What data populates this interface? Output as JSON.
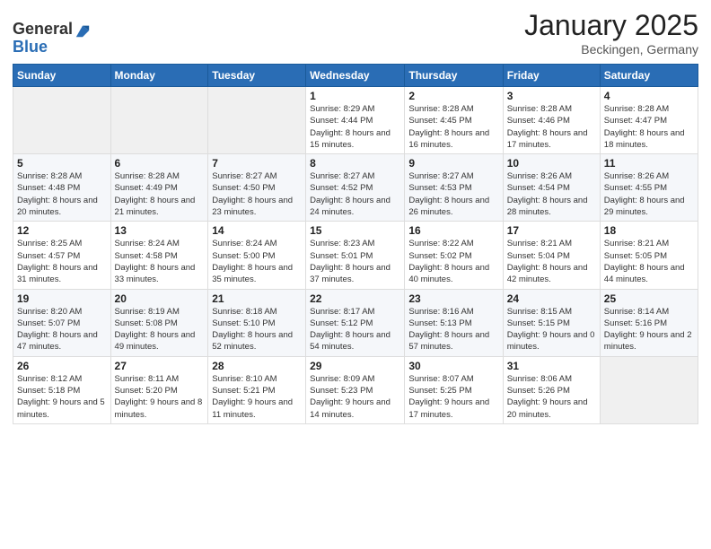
{
  "logo": {
    "general": "General",
    "blue": "Blue"
  },
  "calendar": {
    "title": "January 2025",
    "subtitle": "Beckingen, Germany"
  },
  "days": [
    "Sunday",
    "Monday",
    "Tuesday",
    "Wednesday",
    "Thursday",
    "Friday",
    "Saturday"
  ],
  "weeks": [
    [
      {
        "num": "",
        "info": "",
        "empty": true
      },
      {
        "num": "",
        "info": "",
        "empty": true
      },
      {
        "num": "",
        "info": "",
        "empty": true
      },
      {
        "num": "1",
        "info": "Sunrise: 8:29 AM\nSunset: 4:44 PM\nDaylight: 8 hours\nand 15 minutes."
      },
      {
        "num": "2",
        "info": "Sunrise: 8:28 AM\nSunset: 4:45 PM\nDaylight: 8 hours\nand 16 minutes."
      },
      {
        "num": "3",
        "info": "Sunrise: 8:28 AM\nSunset: 4:46 PM\nDaylight: 8 hours\nand 17 minutes."
      },
      {
        "num": "4",
        "info": "Sunrise: 8:28 AM\nSunset: 4:47 PM\nDaylight: 8 hours\nand 18 minutes."
      }
    ],
    [
      {
        "num": "5",
        "info": "Sunrise: 8:28 AM\nSunset: 4:48 PM\nDaylight: 8 hours\nand 20 minutes."
      },
      {
        "num": "6",
        "info": "Sunrise: 8:28 AM\nSunset: 4:49 PM\nDaylight: 8 hours\nand 21 minutes."
      },
      {
        "num": "7",
        "info": "Sunrise: 8:27 AM\nSunset: 4:50 PM\nDaylight: 8 hours\nand 23 minutes."
      },
      {
        "num": "8",
        "info": "Sunrise: 8:27 AM\nSunset: 4:52 PM\nDaylight: 8 hours\nand 24 minutes."
      },
      {
        "num": "9",
        "info": "Sunrise: 8:27 AM\nSunset: 4:53 PM\nDaylight: 8 hours\nand 26 minutes."
      },
      {
        "num": "10",
        "info": "Sunrise: 8:26 AM\nSunset: 4:54 PM\nDaylight: 8 hours\nand 28 minutes."
      },
      {
        "num": "11",
        "info": "Sunrise: 8:26 AM\nSunset: 4:55 PM\nDaylight: 8 hours\nand 29 minutes."
      }
    ],
    [
      {
        "num": "12",
        "info": "Sunrise: 8:25 AM\nSunset: 4:57 PM\nDaylight: 8 hours\nand 31 minutes."
      },
      {
        "num": "13",
        "info": "Sunrise: 8:24 AM\nSunset: 4:58 PM\nDaylight: 8 hours\nand 33 minutes."
      },
      {
        "num": "14",
        "info": "Sunrise: 8:24 AM\nSunset: 5:00 PM\nDaylight: 8 hours\nand 35 minutes."
      },
      {
        "num": "15",
        "info": "Sunrise: 8:23 AM\nSunset: 5:01 PM\nDaylight: 8 hours\nand 37 minutes."
      },
      {
        "num": "16",
        "info": "Sunrise: 8:22 AM\nSunset: 5:02 PM\nDaylight: 8 hours\nand 40 minutes."
      },
      {
        "num": "17",
        "info": "Sunrise: 8:21 AM\nSunset: 5:04 PM\nDaylight: 8 hours\nand 42 minutes."
      },
      {
        "num": "18",
        "info": "Sunrise: 8:21 AM\nSunset: 5:05 PM\nDaylight: 8 hours\nand 44 minutes."
      }
    ],
    [
      {
        "num": "19",
        "info": "Sunrise: 8:20 AM\nSunset: 5:07 PM\nDaylight: 8 hours\nand 47 minutes."
      },
      {
        "num": "20",
        "info": "Sunrise: 8:19 AM\nSunset: 5:08 PM\nDaylight: 8 hours\nand 49 minutes."
      },
      {
        "num": "21",
        "info": "Sunrise: 8:18 AM\nSunset: 5:10 PM\nDaylight: 8 hours\nand 52 minutes."
      },
      {
        "num": "22",
        "info": "Sunrise: 8:17 AM\nSunset: 5:12 PM\nDaylight: 8 hours\nand 54 minutes."
      },
      {
        "num": "23",
        "info": "Sunrise: 8:16 AM\nSunset: 5:13 PM\nDaylight: 8 hours\nand 57 minutes."
      },
      {
        "num": "24",
        "info": "Sunrise: 8:15 AM\nSunset: 5:15 PM\nDaylight: 9 hours\nand 0 minutes."
      },
      {
        "num": "25",
        "info": "Sunrise: 8:14 AM\nSunset: 5:16 PM\nDaylight: 9 hours\nand 2 minutes."
      }
    ],
    [
      {
        "num": "26",
        "info": "Sunrise: 8:12 AM\nSunset: 5:18 PM\nDaylight: 9 hours\nand 5 minutes."
      },
      {
        "num": "27",
        "info": "Sunrise: 8:11 AM\nSunset: 5:20 PM\nDaylight: 9 hours\nand 8 minutes."
      },
      {
        "num": "28",
        "info": "Sunrise: 8:10 AM\nSunset: 5:21 PM\nDaylight: 9 hours\nand 11 minutes."
      },
      {
        "num": "29",
        "info": "Sunrise: 8:09 AM\nSunset: 5:23 PM\nDaylight: 9 hours\nand 14 minutes."
      },
      {
        "num": "30",
        "info": "Sunrise: 8:07 AM\nSunset: 5:25 PM\nDaylight: 9 hours\nand 17 minutes."
      },
      {
        "num": "31",
        "info": "Sunrise: 8:06 AM\nSunset: 5:26 PM\nDaylight: 9 hours\nand 20 minutes."
      },
      {
        "num": "",
        "info": "",
        "empty": true
      }
    ]
  ]
}
